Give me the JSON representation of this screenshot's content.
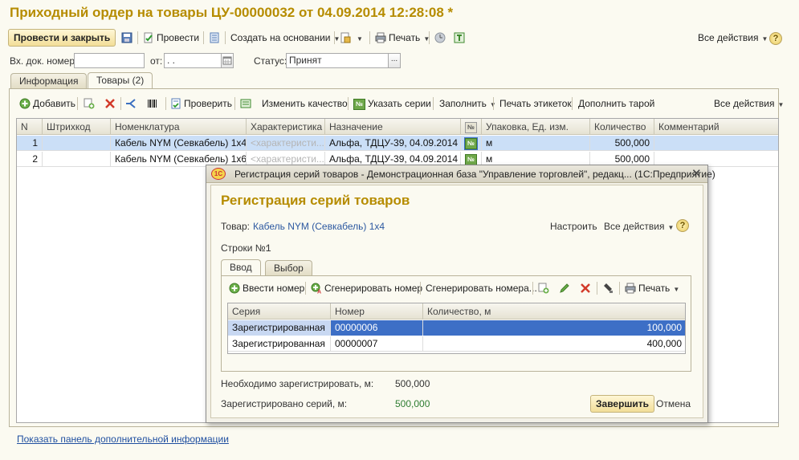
{
  "title": "Приходный ордер на товары ЦУ-00000032 от 04.09.2014 12:28:08 *",
  "toolbar": {
    "post_close": "Провести и закрыть",
    "post": "Провести",
    "create_based": "Создать на основании",
    "print": "Печать",
    "all_actions": "Все действия",
    "help": "?"
  },
  "fields": {
    "incoming_doc_label": "Вх. док. номер:",
    "incoming_doc_value": "",
    "from_label": "от:",
    "from_value": " .  .",
    "status_label": "Статус:",
    "status_value": "Принят",
    "select_btn": "..."
  },
  "tabs": [
    "Информация",
    "Товары (2)"
  ],
  "goods_toolbar": {
    "add": "Добавить",
    "check": "Проверить",
    "change_quality": "Изменить качество",
    "set_series": "Указать серии",
    "fill": "Заполнить",
    "print_labels": "Печать этикеток",
    "fill_tare": "Дополнить тарой",
    "all_actions": "Все действия"
  },
  "goods_table": {
    "columns": [
      "N",
      "Штрихкод",
      "Номенклатура",
      "Характеристика",
      "Назначение",
      "№",
      "Упаковка, Ед. изм.",
      "Количество",
      "Комментарий"
    ],
    "rows": [
      {
        "n": "1",
        "barcode": "",
        "item": "Кабель NYM (Севкабель) 1х4",
        "char": "<характеристи...",
        "purpose": "Альфа, ТДЦУ-39, 04.09.2014 ...",
        "series_icon": "№",
        "unit": "м",
        "qty": "500,000",
        "comment": ""
      },
      {
        "n": "2",
        "barcode": "",
        "item": "Кабель NYM (Севкабель) 1х6",
        "char": "<характеристи...",
        "purpose": "Альфа, ТДЦУ-39, 04.09.2014 ...",
        "series_icon": "№",
        "unit": "м",
        "qty": "500,000",
        "comment": ""
      }
    ]
  },
  "footer_link": "Показать панель дополнительной информации",
  "modal": {
    "window_title": "Регистрация серий товаров - Демонстрационная база \"Управление торговлей\", редакц... (1С:Предприятие)",
    "logo": "1С",
    "heading": "Регистрация серий товаров",
    "goods_label": "Товар:",
    "goods_value": "Кабель NYM (Севкабель) 1х4",
    "configure": "Настроить",
    "all_actions": "Все действия",
    "rows_label": "Строки №:",
    "rows_value": "1",
    "tabs": [
      "Ввод",
      "Выбор"
    ],
    "toolbar": {
      "enter_number": "Ввести номер",
      "generate_number": "Сгенерировать номер",
      "generate_numbers": "Сгенерировать номера...",
      "print": "Печать"
    },
    "table": {
      "columns": [
        "Серия",
        "Номер",
        "Количество, м"
      ],
      "rows": [
        {
          "series": "Зарегистрированная",
          "number": "00000006",
          "qty": "100,000"
        },
        {
          "series": "Зарегистрированная",
          "number": "00000007",
          "qty": "400,000"
        }
      ]
    },
    "need_label": "Необходимо зарегистрировать, м:",
    "need_value": "500,000",
    "registered_label": "Зарегистрировано серий, м:",
    "registered_value": "500,000",
    "finish": "Завершить",
    "cancel": "Отмена"
  }
}
